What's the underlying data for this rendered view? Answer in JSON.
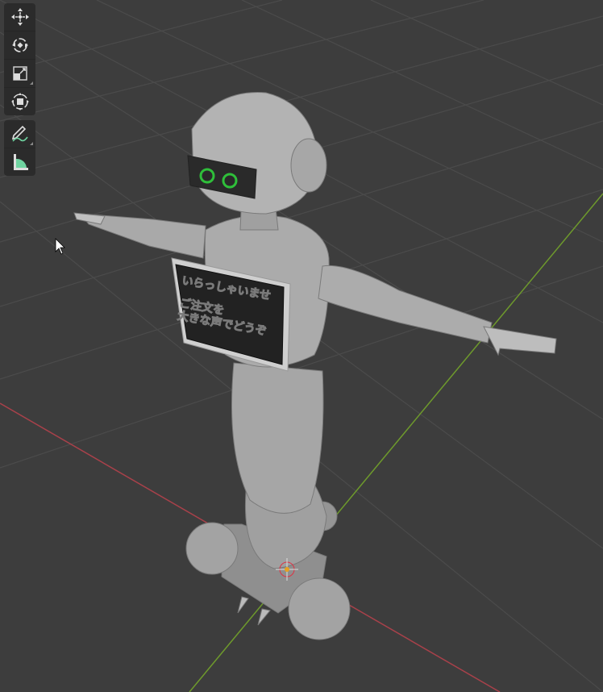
{
  "viewport": {
    "background": "#3d3d3d",
    "grid_color": "#4a4a4a",
    "x_axis_color": "#a8414a",
    "y_axis_color": "#6e9a2c"
  },
  "toolbar": {
    "group1": [
      {
        "name": "move",
        "icon": "move-icon"
      },
      {
        "name": "rotate",
        "icon": "rotate-icon"
      },
      {
        "name": "scale",
        "icon": "scale-icon"
      },
      {
        "name": "transform",
        "icon": "transform-icon"
      }
    ],
    "group2": [
      {
        "name": "annotate",
        "icon": "annotate-icon"
      },
      {
        "name": "measure",
        "icon": "measure-icon"
      }
    ]
  },
  "model": {
    "sign_lines": [
      "いらっしゃいませ",
      "ご注文を",
      "大きな声でどうぞ"
    ],
    "eye_color": "#2fbf3a"
  }
}
